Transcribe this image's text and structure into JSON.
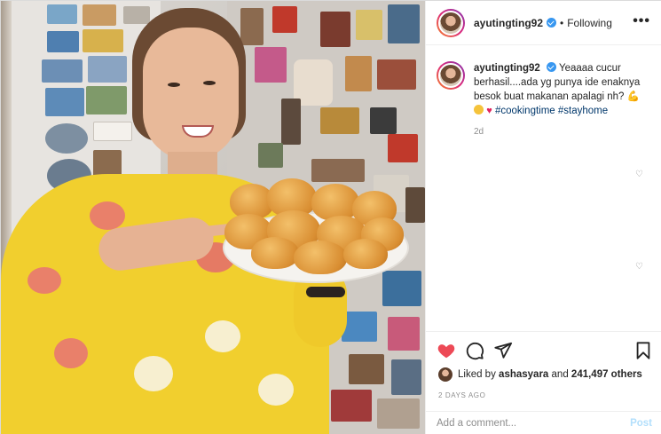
{
  "post": {
    "username": "ayutingting92",
    "follow_status": "Following",
    "separator": "•",
    "more_label": "•••"
  },
  "caption": {
    "username": "ayutingting92",
    "text": "Yeaaaa cucur berhasil....ada yg punya ide enaknya besok buat makanan apalagi nh?",
    "hashtag_1": "#cookingtime",
    "hashtag_2": "#stayhome",
    "age": "2d"
  },
  "likes": {
    "prefix": "Liked by",
    "user": "ashasyara",
    "and": "and",
    "count": "241,497 others"
  },
  "date": "2 DAYS AGO",
  "add_comment": {
    "placeholder": "Add a comment...",
    "post_label": "Post"
  },
  "icons": {
    "like": "heart-filled-icon",
    "comment": "comment-icon",
    "share": "share-icon",
    "save": "bookmark-icon"
  },
  "colors": {
    "like_red": "#ed4956",
    "verified_blue": "#3897f0",
    "post_disabled": "#b2dffc"
  }
}
